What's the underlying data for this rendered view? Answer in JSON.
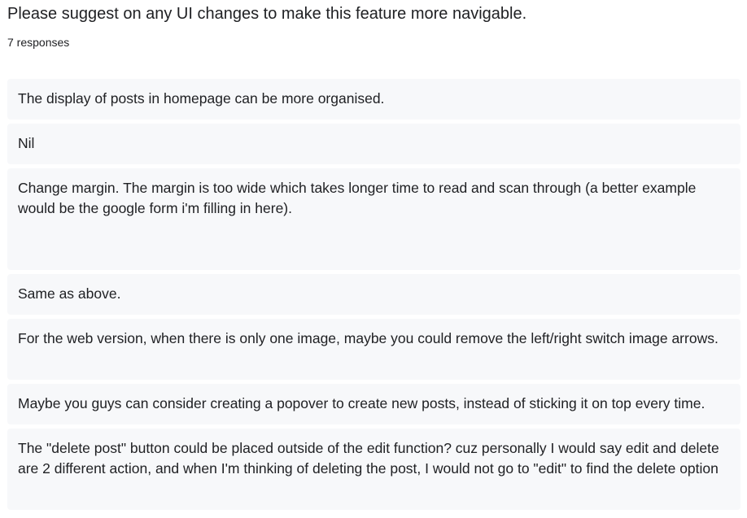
{
  "question": {
    "title": "Please suggest on any UI changes to make this feature more navigable.",
    "response_count": "7 responses"
  },
  "responses": [
    "The display of posts in homepage can be more organised.",
    "Nil",
    "Change margin. The margin is too wide which takes longer time to read and scan through (a better example would be the google form i'm filling in here).",
    "Same as above.",
    "For the web version, when there is only one image, maybe you could remove the left/right switch image arrows.",
    "Maybe you guys can consider creating a popover to create new posts, instead of sticking it on top every time.",
    "The \"delete post\" button could be placed outside of the edit function? cuz personally I would say edit and delete are 2 different action, and when I'm thinking of deleting the post, I would not go to \"edit\" to find the delete option"
  ]
}
